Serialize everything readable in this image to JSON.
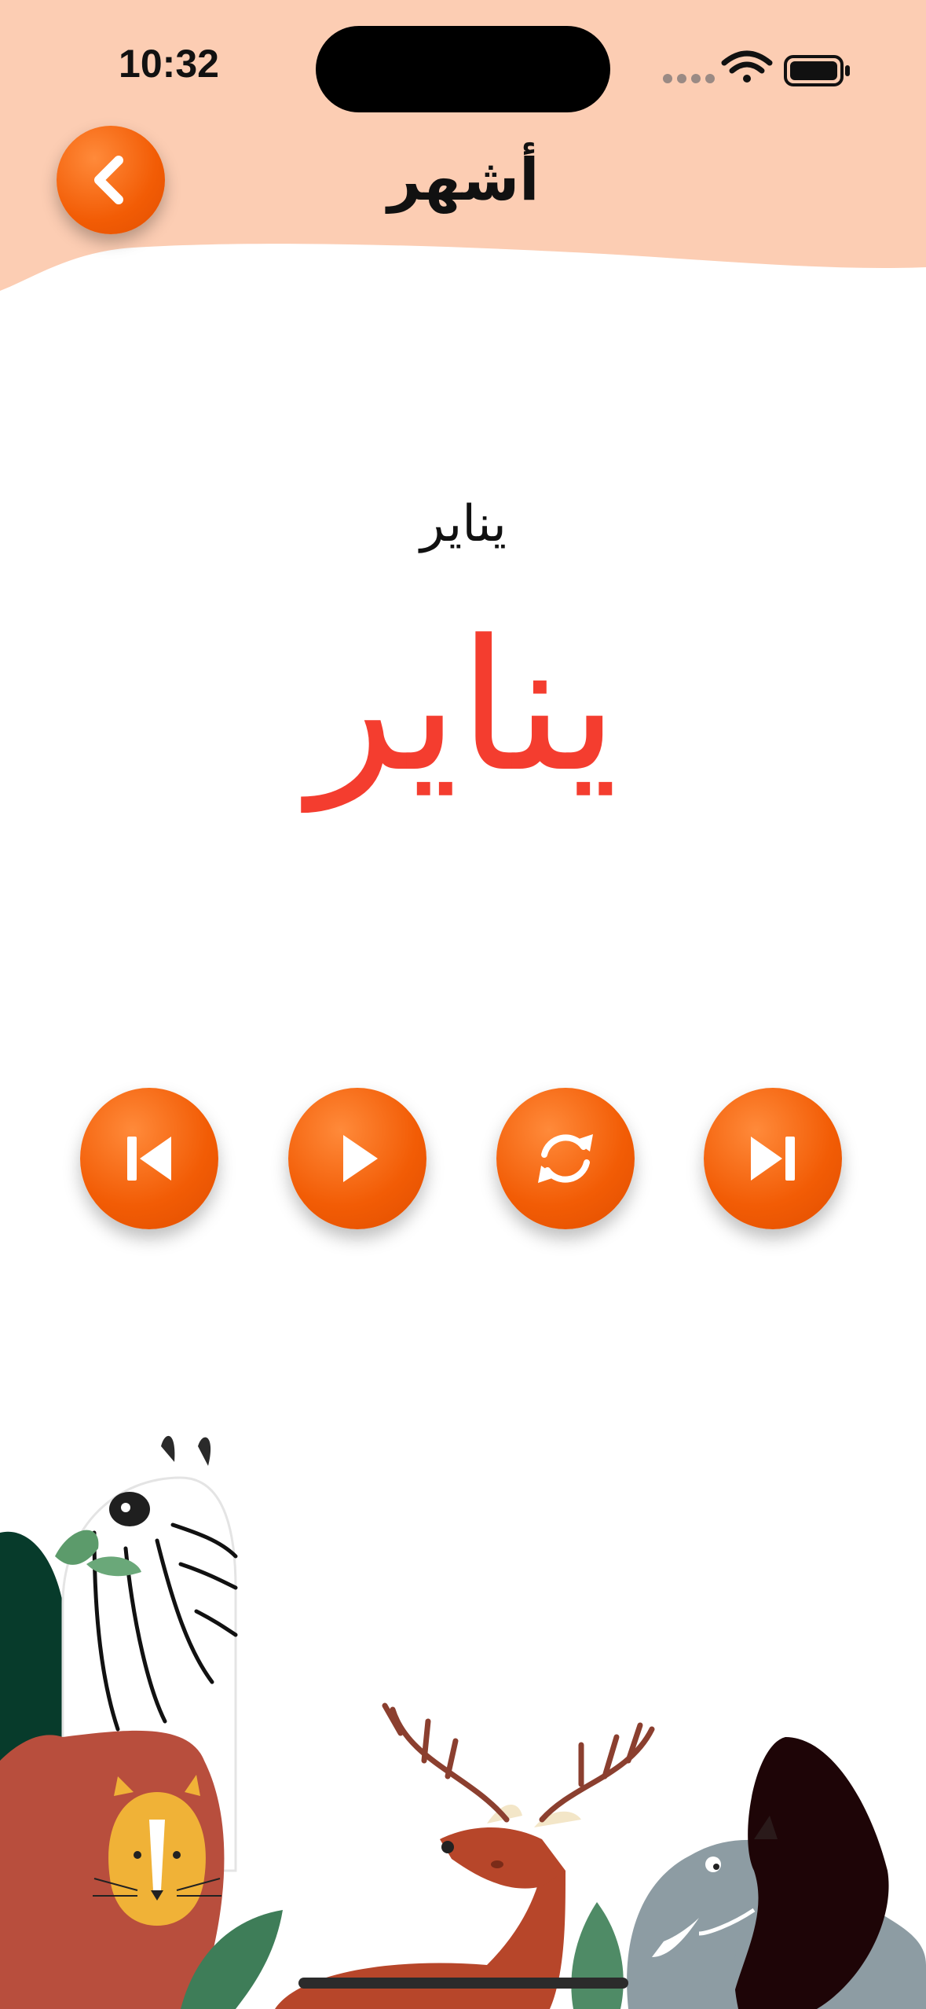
{
  "status_bar": {
    "time": "10:32",
    "icons": [
      "cellular-dots-icon",
      "wifi-icon",
      "battery-icon"
    ]
  },
  "header": {
    "title": "أشهر",
    "back_icon": "chevron-left-icon"
  },
  "main": {
    "word_small": "يناير",
    "word_large": "يناير"
  },
  "controls": [
    {
      "name": "previous",
      "icon": "skip-previous-icon"
    },
    {
      "name": "play",
      "icon": "play-icon"
    },
    {
      "name": "repeat",
      "icon": "refresh-icon"
    },
    {
      "name": "next",
      "icon": "skip-next-icon"
    }
  ],
  "colors": {
    "header_bg": "#fccdb3",
    "accent": "#f25c05",
    "word_large": "#f43d2f"
  },
  "illustration": [
    "zebra",
    "lion",
    "deer",
    "elephant",
    "leaves"
  ]
}
